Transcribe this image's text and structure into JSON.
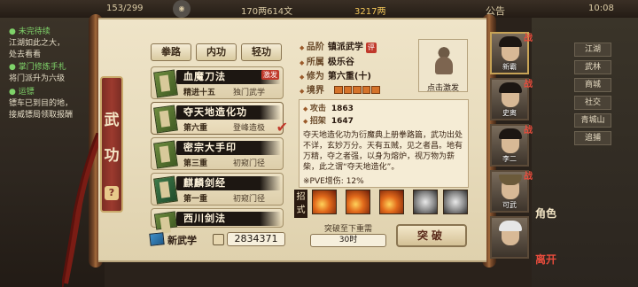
{
  "top_bar": {
    "shop_label": "",
    "stamina": "153/299",
    "cost": "170两614文",
    "silver": "3217两",
    "announce": "公告",
    "time": "10:08"
  },
  "quests": [
    {
      "title": "● 未完待续",
      "body": "江湖如此之大，\n处去看看"
    },
    {
      "title": "● 掌门修炼手札",
      "body": "将门派升为六级"
    },
    {
      "title": "● 运镖",
      "body": "镖车已到目的地，\n接威镖局领取报酬"
    }
  ],
  "side_buttons": [
    "江湖",
    "武林",
    "商城",
    "社交",
    "青城山",
    "追捕"
  ],
  "panel": {
    "category_label": [
      "武",
      "功"
    ],
    "tabs": [
      "拳路",
      "内功",
      "轻功"
    ],
    "skills": [
      {
        "name": "血魔刀法",
        "level": "精进十五",
        "tag": "独门武学",
        "badge": "激发"
      },
      {
        "name": "夺天地造化功",
        "level": "第六重",
        "tag": "登峰造极"
      },
      {
        "name": "密宗大手印",
        "level": "第三重",
        "tag": "初窥门径"
      },
      {
        "name": "麒麟剑经",
        "level": "第一重",
        "tag": "初窥门径"
      },
      {
        "name": "西川剑法",
        "level": "",
        "tag": ""
      }
    ],
    "new_skill_label": "新武学",
    "points": "2834371"
  },
  "detail": {
    "rank_key": "品阶",
    "rank": "镇派武学",
    "rank_mark": "评",
    "school_key": "所属",
    "school": "极乐谷",
    "cult_key": "修为",
    "cult": "第六重(十)",
    "realm_key": "境界",
    "figure_caption": "点击激发",
    "atk_key": "攻击",
    "atk": "1863",
    "parry_key": "招架",
    "parry": "1647",
    "description": "夺天地造化功为衍魔典上册拳路篇，武功出处不详，玄妙万分。天有五贼，见之者昌。地有万精，夺之者强，以身为熔炉，视万物为薪柴，此之谓“夺天地造化”。",
    "pve": "※PVE增伤: 12%",
    "moves_label": [
      "招",
      "式"
    ],
    "moves": [
      "fire-move-icon",
      "fire-move-icon",
      "fire-move-icon",
      "grey-move-icon",
      "grey-move-icon",
      "grey-move-icon"
    ],
    "break_requirement": "突破至下重需",
    "break_time": "30时",
    "break_button": "突破"
  },
  "characters": [
    {
      "name": "新霸",
      "mark": "战"
    },
    {
      "name": "史离",
      "mark": "战"
    },
    {
      "name": "李二",
      "mark": "战"
    },
    {
      "name": "可武",
      "mark": "战"
    },
    {
      "name": "",
      "mark": ""
    }
  ],
  "side_tabs": [
    "角色",
    "离开"
  ],
  "colors": {
    "accent_red": "#c0392b",
    "parchment": "#efe4c8",
    "ink": "#1d1712"
  }
}
